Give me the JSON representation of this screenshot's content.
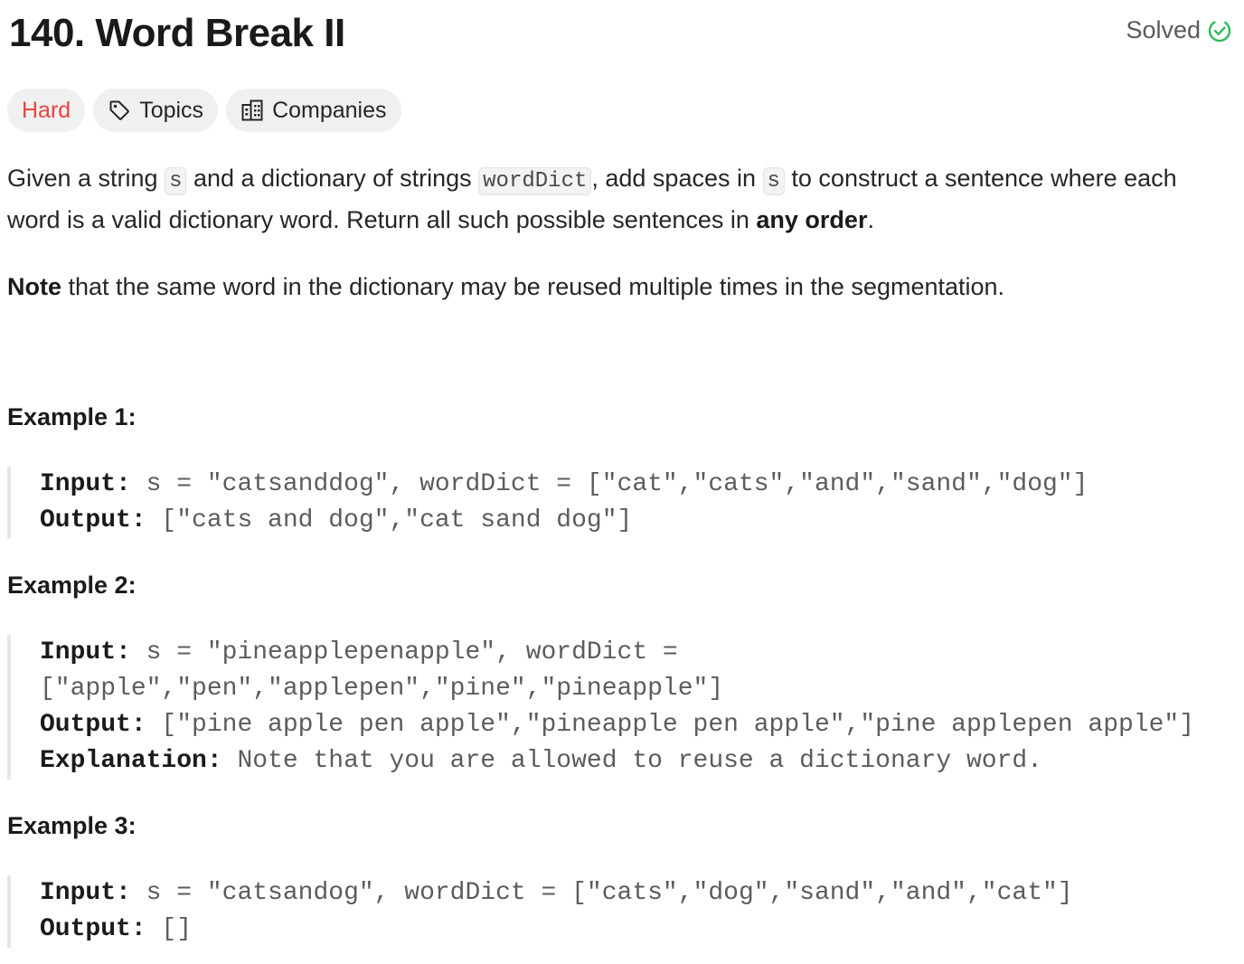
{
  "problem": {
    "title": "140. Word Break II",
    "status": "Solved",
    "difficulty": "Hard",
    "topics_label": "Topics",
    "companies_label": "Companies"
  },
  "description": {
    "p1_a": "Given a string ",
    "p1_code1": "s",
    "p1_b": " and a dictionary of strings ",
    "p1_code2": "wordDict",
    "p1_c": ", add spaces in ",
    "p1_code3": "s",
    "p1_d": " to construct a sentence where each word is a valid dictionary word. Return all such possible sentences in ",
    "p1_bold": "any order",
    "p1_e": ".",
    "note_bold": "Note",
    "note_text": " that the same word in the dictionary may be reused multiple times in the segmentation."
  },
  "examples": [
    {
      "title": "Example 1:",
      "lines": [
        {
          "label": "Input:",
          "text": " s = \"catsanddog\", wordDict = [\"cat\",\"cats\",\"and\",\"sand\",\"dog\"]"
        },
        {
          "label": "Output:",
          "text": " [\"cats and dog\",\"cat sand dog\"]"
        }
      ]
    },
    {
      "title": "Example 2:",
      "lines": [
        {
          "label": "Input:",
          "text": " s = \"pineapplepenapple\", wordDict ="
        },
        {
          "label": "",
          "text": "[\"apple\",\"pen\",\"applepen\",\"pine\",\"pineapple\"]"
        },
        {
          "label": "Output:",
          "text": " [\"pine apple pen apple\",\"pineapple pen apple\",\"pine applepen apple\"]"
        },
        {
          "label": "Explanation:",
          "text": " Note that you are allowed to reuse a dictionary word."
        }
      ]
    },
    {
      "title": "Example 3:",
      "lines": [
        {
          "label": "Input:",
          "text": " s = \"catsandog\", wordDict = [\"cats\",\"dog\",\"sand\",\"and\",\"cat\"]"
        },
        {
          "label": "Output:",
          "text": " []"
        }
      ]
    }
  ],
  "icons": {
    "solved": "check-circle-icon",
    "topics": "tag-icon",
    "companies": "building-icon"
  },
  "colors": {
    "hard": "#e8453c",
    "solved_check": "#2cbb5d",
    "tag_bg": "#f0f0f0"
  }
}
